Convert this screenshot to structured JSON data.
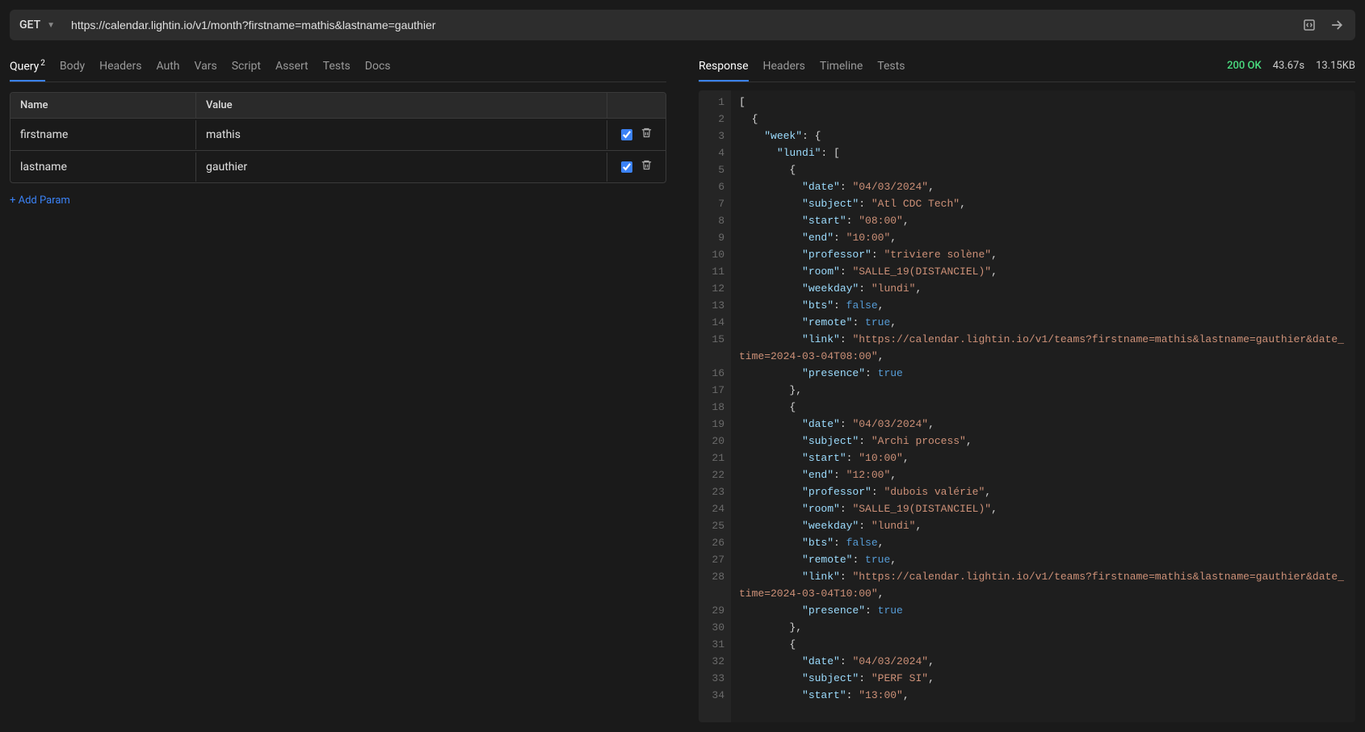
{
  "request": {
    "method": "GET",
    "url": "https://calendar.lightin.io/v1/month?firstname=mathis&lastname=gauthier"
  },
  "left_tabs": [
    {
      "label": "Query",
      "badge": "2",
      "active": true
    },
    {
      "label": "Body"
    },
    {
      "label": "Headers"
    },
    {
      "label": "Auth"
    },
    {
      "label": "Vars"
    },
    {
      "label": "Script"
    },
    {
      "label": "Assert"
    },
    {
      "label": "Tests"
    },
    {
      "label": "Docs"
    }
  ],
  "params_header": {
    "name": "Name",
    "value": "Value"
  },
  "params": [
    {
      "name": "firstname",
      "value": "mathis",
      "enabled": true
    },
    {
      "name": "lastname",
      "value": "gauthier",
      "enabled": true
    }
  ],
  "add_param_label": "+ Add Param",
  "right_tabs": [
    {
      "label": "Response",
      "active": true
    },
    {
      "label": "Headers"
    },
    {
      "label": "Timeline"
    },
    {
      "label": "Tests"
    }
  ],
  "response_status": {
    "code": "200 OK",
    "time": "43.67s",
    "size": "13.15KB"
  },
  "response_lines": [
    [
      {
        "t": "punc",
        "v": "["
      }
    ],
    [
      {
        "t": "punc",
        "v": "  {"
      }
    ],
    [
      {
        "t": "punc",
        "v": "    "
      },
      {
        "t": "key",
        "v": "\"week\""
      },
      {
        "t": "punc",
        "v": ": {"
      }
    ],
    [
      {
        "t": "punc",
        "v": "      "
      },
      {
        "t": "key",
        "v": "\"lundi\""
      },
      {
        "t": "punc",
        "v": ": ["
      }
    ],
    [
      {
        "t": "punc",
        "v": "        {"
      }
    ],
    [
      {
        "t": "punc",
        "v": "          "
      },
      {
        "t": "key",
        "v": "\"date\""
      },
      {
        "t": "punc",
        "v": ": "
      },
      {
        "t": "str",
        "v": "\"04/03/2024\""
      },
      {
        "t": "punc",
        "v": ","
      }
    ],
    [
      {
        "t": "punc",
        "v": "          "
      },
      {
        "t": "key",
        "v": "\"subject\""
      },
      {
        "t": "punc",
        "v": ": "
      },
      {
        "t": "str",
        "v": "\"Atl CDC Tech\""
      },
      {
        "t": "punc",
        "v": ","
      }
    ],
    [
      {
        "t": "punc",
        "v": "          "
      },
      {
        "t": "key",
        "v": "\"start\""
      },
      {
        "t": "punc",
        "v": ": "
      },
      {
        "t": "str",
        "v": "\"08:00\""
      },
      {
        "t": "punc",
        "v": ","
      }
    ],
    [
      {
        "t": "punc",
        "v": "          "
      },
      {
        "t": "key",
        "v": "\"end\""
      },
      {
        "t": "punc",
        "v": ": "
      },
      {
        "t": "str",
        "v": "\"10:00\""
      },
      {
        "t": "punc",
        "v": ","
      }
    ],
    [
      {
        "t": "punc",
        "v": "          "
      },
      {
        "t": "key",
        "v": "\"professor\""
      },
      {
        "t": "punc",
        "v": ": "
      },
      {
        "t": "str",
        "v": "\"triviere solène\""
      },
      {
        "t": "punc",
        "v": ","
      }
    ],
    [
      {
        "t": "punc",
        "v": "          "
      },
      {
        "t": "key",
        "v": "\"room\""
      },
      {
        "t": "punc",
        "v": ": "
      },
      {
        "t": "str",
        "v": "\"SALLE_19(DISTANCIEL)\""
      },
      {
        "t": "punc",
        "v": ","
      }
    ],
    [
      {
        "t": "punc",
        "v": "          "
      },
      {
        "t": "key",
        "v": "\"weekday\""
      },
      {
        "t": "punc",
        "v": ": "
      },
      {
        "t": "str",
        "v": "\"lundi\""
      },
      {
        "t": "punc",
        "v": ","
      }
    ],
    [
      {
        "t": "punc",
        "v": "          "
      },
      {
        "t": "key",
        "v": "\"bts\""
      },
      {
        "t": "punc",
        "v": ": "
      },
      {
        "t": "bool",
        "v": "false"
      },
      {
        "t": "punc",
        "v": ","
      }
    ],
    [
      {
        "t": "punc",
        "v": "          "
      },
      {
        "t": "key",
        "v": "\"remote\""
      },
      {
        "t": "punc",
        "v": ": "
      },
      {
        "t": "bool",
        "v": "true"
      },
      {
        "t": "punc",
        "v": ","
      }
    ],
    [
      {
        "t": "punc",
        "v": "          "
      },
      {
        "t": "key",
        "v": "\"link\""
      },
      {
        "t": "punc",
        "v": ": "
      },
      {
        "t": "str",
        "v": "\"https://calendar.lightin.io/v1/teams?firstname=mathis&lastname=gauthier&date_time=2024-03-04T08:00\""
      },
      {
        "t": "punc",
        "v": ","
      }
    ],
    [
      {
        "t": "punc",
        "v": "          "
      },
      {
        "t": "key",
        "v": "\"presence\""
      },
      {
        "t": "punc",
        "v": ": "
      },
      {
        "t": "bool",
        "v": "true"
      }
    ],
    [
      {
        "t": "punc",
        "v": "        },"
      }
    ],
    [
      {
        "t": "punc",
        "v": "        {"
      }
    ],
    [
      {
        "t": "punc",
        "v": "          "
      },
      {
        "t": "key",
        "v": "\"date\""
      },
      {
        "t": "punc",
        "v": ": "
      },
      {
        "t": "str",
        "v": "\"04/03/2024\""
      },
      {
        "t": "punc",
        "v": ","
      }
    ],
    [
      {
        "t": "punc",
        "v": "          "
      },
      {
        "t": "key",
        "v": "\"subject\""
      },
      {
        "t": "punc",
        "v": ": "
      },
      {
        "t": "str",
        "v": "\"Archi process\""
      },
      {
        "t": "punc",
        "v": ","
      }
    ],
    [
      {
        "t": "punc",
        "v": "          "
      },
      {
        "t": "key",
        "v": "\"start\""
      },
      {
        "t": "punc",
        "v": ": "
      },
      {
        "t": "str",
        "v": "\"10:00\""
      },
      {
        "t": "punc",
        "v": ","
      }
    ],
    [
      {
        "t": "punc",
        "v": "          "
      },
      {
        "t": "key",
        "v": "\"end\""
      },
      {
        "t": "punc",
        "v": ": "
      },
      {
        "t": "str",
        "v": "\"12:00\""
      },
      {
        "t": "punc",
        "v": ","
      }
    ],
    [
      {
        "t": "punc",
        "v": "          "
      },
      {
        "t": "key",
        "v": "\"professor\""
      },
      {
        "t": "punc",
        "v": ": "
      },
      {
        "t": "str",
        "v": "\"dubois valérie\""
      },
      {
        "t": "punc",
        "v": ","
      }
    ],
    [
      {
        "t": "punc",
        "v": "          "
      },
      {
        "t": "key",
        "v": "\"room\""
      },
      {
        "t": "punc",
        "v": ": "
      },
      {
        "t": "str",
        "v": "\"SALLE_19(DISTANCIEL)\""
      },
      {
        "t": "punc",
        "v": ","
      }
    ],
    [
      {
        "t": "punc",
        "v": "          "
      },
      {
        "t": "key",
        "v": "\"weekday\""
      },
      {
        "t": "punc",
        "v": ": "
      },
      {
        "t": "str",
        "v": "\"lundi\""
      },
      {
        "t": "punc",
        "v": ","
      }
    ],
    [
      {
        "t": "punc",
        "v": "          "
      },
      {
        "t": "key",
        "v": "\"bts\""
      },
      {
        "t": "punc",
        "v": ": "
      },
      {
        "t": "bool",
        "v": "false"
      },
      {
        "t": "punc",
        "v": ","
      }
    ],
    [
      {
        "t": "punc",
        "v": "          "
      },
      {
        "t": "key",
        "v": "\"remote\""
      },
      {
        "t": "punc",
        "v": ": "
      },
      {
        "t": "bool",
        "v": "true"
      },
      {
        "t": "punc",
        "v": ","
      }
    ],
    [
      {
        "t": "punc",
        "v": "          "
      },
      {
        "t": "key",
        "v": "\"link\""
      },
      {
        "t": "punc",
        "v": ": "
      },
      {
        "t": "str",
        "v": "\"https://calendar.lightin.io/v1/teams?firstname=mathis&lastname=gauthier&date_time=2024-03-04T10:00\""
      },
      {
        "t": "punc",
        "v": ","
      }
    ],
    [
      {
        "t": "punc",
        "v": "          "
      },
      {
        "t": "key",
        "v": "\"presence\""
      },
      {
        "t": "punc",
        "v": ": "
      },
      {
        "t": "bool",
        "v": "true"
      }
    ],
    [
      {
        "t": "punc",
        "v": "        },"
      }
    ],
    [
      {
        "t": "punc",
        "v": "        {"
      }
    ],
    [
      {
        "t": "punc",
        "v": "          "
      },
      {
        "t": "key",
        "v": "\"date\""
      },
      {
        "t": "punc",
        "v": ": "
      },
      {
        "t": "str",
        "v": "\"04/03/2024\""
      },
      {
        "t": "punc",
        "v": ","
      }
    ],
    [
      {
        "t": "punc",
        "v": "          "
      },
      {
        "t": "key",
        "v": "\"subject\""
      },
      {
        "t": "punc",
        "v": ": "
      },
      {
        "t": "str",
        "v": "\"PERF SI\""
      },
      {
        "t": "punc",
        "v": ","
      }
    ],
    [
      {
        "t": "punc",
        "v": "          "
      },
      {
        "t": "key",
        "v": "\"start\""
      },
      {
        "t": "punc",
        "v": ": "
      },
      {
        "t": "str",
        "v": "\"13:00\""
      },
      {
        "t": "punc",
        "v": ","
      }
    ]
  ]
}
